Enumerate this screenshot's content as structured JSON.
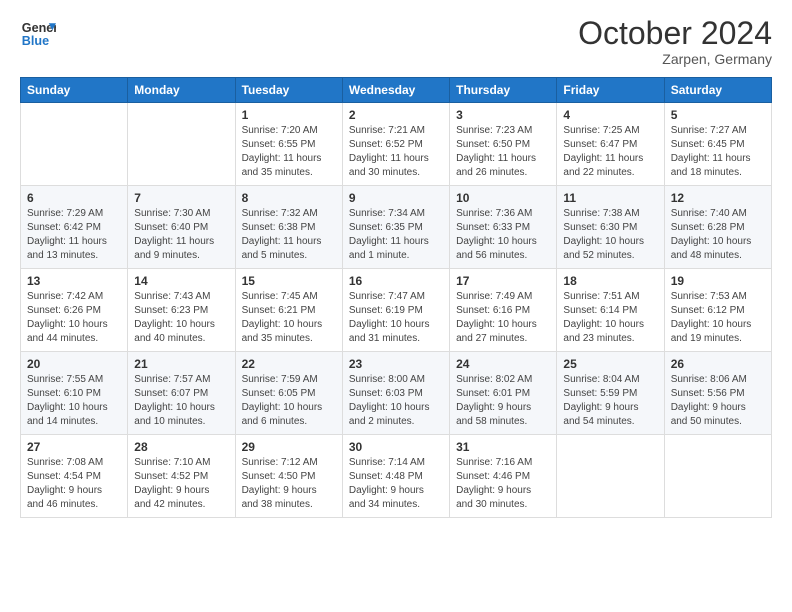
{
  "logo": {
    "line1": "General",
    "line2": "Blue"
  },
  "title": "October 2024",
  "location": "Zarpen, Germany",
  "weekdays": [
    "Sunday",
    "Monday",
    "Tuesday",
    "Wednesday",
    "Thursday",
    "Friday",
    "Saturday"
  ],
  "weeks": [
    [
      {
        "day": "",
        "info": ""
      },
      {
        "day": "",
        "info": ""
      },
      {
        "day": "1",
        "info": "Sunrise: 7:20 AM\nSunset: 6:55 PM\nDaylight: 11 hours and 35 minutes."
      },
      {
        "day": "2",
        "info": "Sunrise: 7:21 AM\nSunset: 6:52 PM\nDaylight: 11 hours and 30 minutes."
      },
      {
        "day": "3",
        "info": "Sunrise: 7:23 AM\nSunset: 6:50 PM\nDaylight: 11 hours and 26 minutes."
      },
      {
        "day": "4",
        "info": "Sunrise: 7:25 AM\nSunset: 6:47 PM\nDaylight: 11 hours and 22 minutes."
      },
      {
        "day": "5",
        "info": "Sunrise: 7:27 AM\nSunset: 6:45 PM\nDaylight: 11 hours and 18 minutes."
      }
    ],
    [
      {
        "day": "6",
        "info": "Sunrise: 7:29 AM\nSunset: 6:42 PM\nDaylight: 11 hours and 13 minutes."
      },
      {
        "day": "7",
        "info": "Sunrise: 7:30 AM\nSunset: 6:40 PM\nDaylight: 11 hours and 9 minutes."
      },
      {
        "day": "8",
        "info": "Sunrise: 7:32 AM\nSunset: 6:38 PM\nDaylight: 11 hours and 5 minutes."
      },
      {
        "day": "9",
        "info": "Sunrise: 7:34 AM\nSunset: 6:35 PM\nDaylight: 11 hours and 1 minute."
      },
      {
        "day": "10",
        "info": "Sunrise: 7:36 AM\nSunset: 6:33 PM\nDaylight: 10 hours and 56 minutes."
      },
      {
        "day": "11",
        "info": "Sunrise: 7:38 AM\nSunset: 6:30 PM\nDaylight: 10 hours and 52 minutes."
      },
      {
        "day": "12",
        "info": "Sunrise: 7:40 AM\nSunset: 6:28 PM\nDaylight: 10 hours and 48 minutes."
      }
    ],
    [
      {
        "day": "13",
        "info": "Sunrise: 7:42 AM\nSunset: 6:26 PM\nDaylight: 10 hours and 44 minutes."
      },
      {
        "day": "14",
        "info": "Sunrise: 7:43 AM\nSunset: 6:23 PM\nDaylight: 10 hours and 40 minutes."
      },
      {
        "day": "15",
        "info": "Sunrise: 7:45 AM\nSunset: 6:21 PM\nDaylight: 10 hours and 35 minutes."
      },
      {
        "day": "16",
        "info": "Sunrise: 7:47 AM\nSunset: 6:19 PM\nDaylight: 10 hours and 31 minutes."
      },
      {
        "day": "17",
        "info": "Sunrise: 7:49 AM\nSunset: 6:16 PM\nDaylight: 10 hours and 27 minutes."
      },
      {
        "day": "18",
        "info": "Sunrise: 7:51 AM\nSunset: 6:14 PM\nDaylight: 10 hours and 23 minutes."
      },
      {
        "day": "19",
        "info": "Sunrise: 7:53 AM\nSunset: 6:12 PM\nDaylight: 10 hours and 19 minutes."
      }
    ],
    [
      {
        "day": "20",
        "info": "Sunrise: 7:55 AM\nSunset: 6:10 PM\nDaylight: 10 hours and 14 minutes."
      },
      {
        "day": "21",
        "info": "Sunrise: 7:57 AM\nSunset: 6:07 PM\nDaylight: 10 hours and 10 minutes."
      },
      {
        "day": "22",
        "info": "Sunrise: 7:59 AM\nSunset: 6:05 PM\nDaylight: 10 hours and 6 minutes."
      },
      {
        "day": "23",
        "info": "Sunrise: 8:00 AM\nSunset: 6:03 PM\nDaylight: 10 hours and 2 minutes."
      },
      {
        "day": "24",
        "info": "Sunrise: 8:02 AM\nSunset: 6:01 PM\nDaylight: 9 hours and 58 minutes."
      },
      {
        "day": "25",
        "info": "Sunrise: 8:04 AM\nSunset: 5:59 PM\nDaylight: 9 hours and 54 minutes."
      },
      {
        "day": "26",
        "info": "Sunrise: 8:06 AM\nSunset: 5:56 PM\nDaylight: 9 hours and 50 minutes."
      }
    ],
    [
      {
        "day": "27",
        "info": "Sunrise: 7:08 AM\nSunset: 4:54 PM\nDaylight: 9 hours and 46 minutes."
      },
      {
        "day": "28",
        "info": "Sunrise: 7:10 AM\nSunset: 4:52 PM\nDaylight: 9 hours and 42 minutes."
      },
      {
        "day": "29",
        "info": "Sunrise: 7:12 AM\nSunset: 4:50 PM\nDaylight: 9 hours and 38 minutes."
      },
      {
        "day": "30",
        "info": "Sunrise: 7:14 AM\nSunset: 4:48 PM\nDaylight: 9 hours and 34 minutes."
      },
      {
        "day": "31",
        "info": "Sunrise: 7:16 AM\nSunset: 4:46 PM\nDaylight: 9 hours and 30 minutes."
      },
      {
        "day": "",
        "info": ""
      },
      {
        "day": "",
        "info": ""
      }
    ]
  ]
}
